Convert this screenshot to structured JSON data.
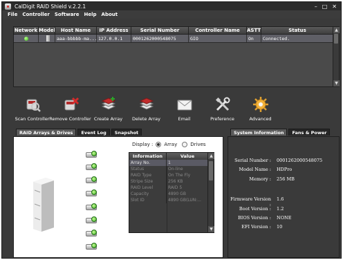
{
  "window": {
    "title": "CalDigit RAID Shield v.2.2.1"
  },
  "menu": [
    "File",
    "Controller",
    "Software",
    "Help",
    "About"
  ],
  "controller_table": {
    "headers": [
      "Network",
      "Model",
      "Host Name",
      "IP Address",
      "Serial Number",
      "Controller Name",
      "ASTT",
      "Status"
    ],
    "rows": [
      {
        "network": "",
        "model": "",
        "host": "aaa-bbbbb-ma...",
        "ip": "127.0.0.1",
        "serial": "0001262000548075",
        "name": "GIO",
        "astt": "On",
        "status": "Connected."
      }
    ]
  },
  "toolbar": [
    {
      "label": "Scan Controller",
      "icon": "scan-controller-icon"
    },
    {
      "label": "Remove Controller",
      "icon": "remove-controller-icon"
    },
    {
      "label": "Create Array",
      "icon": "create-array-icon"
    },
    {
      "label": "Delete Array",
      "icon": "delete-array-icon"
    },
    {
      "label": "Email",
      "icon": "email-icon"
    },
    {
      "label": "Preference",
      "icon": "preference-icon"
    },
    {
      "label": "Advanced",
      "icon": "advanced-icon"
    }
  ],
  "tabs_left": [
    "RAID Arrays & Drives",
    "Event Log",
    "Snapshot"
  ],
  "tabs_right": [
    "System Information",
    "Fans & Power"
  ],
  "display": {
    "label": "Display :",
    "option_array": "Array",
    "option_drives": "Drives"
  },
  "info_table": {
    "headers": [
      "Information",
      "Value"
    ],
    "rows": [
      {
        "k": "Array No.",
        "v": "1"
      },
      {
        "k": "Status",
        "v": "On-line"
      },
      {
        "k": "RAID Type",
        "v": "On The Fly"
      },
      {
        "k": "Stripe Size",
        "v": "256 KB"
      },
      {
        "k": "RAID Level",
        "v": "RAID 5"
      },
      {
        "k": "Capacity",
        "v": "4890 GB"
      },
      {
        "k": "Slot ID",
        "v": "4890 GB(LUN:..."
      }
    ]
  },
  "system_info": {
    "serial_label": "Serial Number :",
    "serial": "0001262000548075",
    "model_label": "Model Name :",
    "model": "HDPro",
    "memory_label": "Memory :",
    "memory": "256 MB",
    "firmware_label": "Firmware Version :",
    "firmware": "1.6",
    "boot_label": "Boot Version :",
    "boot": "1.2",
    "bios_label": "BIOS Version :",
    "bios": "NONE",
    "efi_label": "EFI Version :",
    "efi": "10"
  },
  "colors": {
    "window_bg": "#3a3a3a",
    "status_green": "#3ab01e",
    "panel_white": "#ffffff"
  }
}
